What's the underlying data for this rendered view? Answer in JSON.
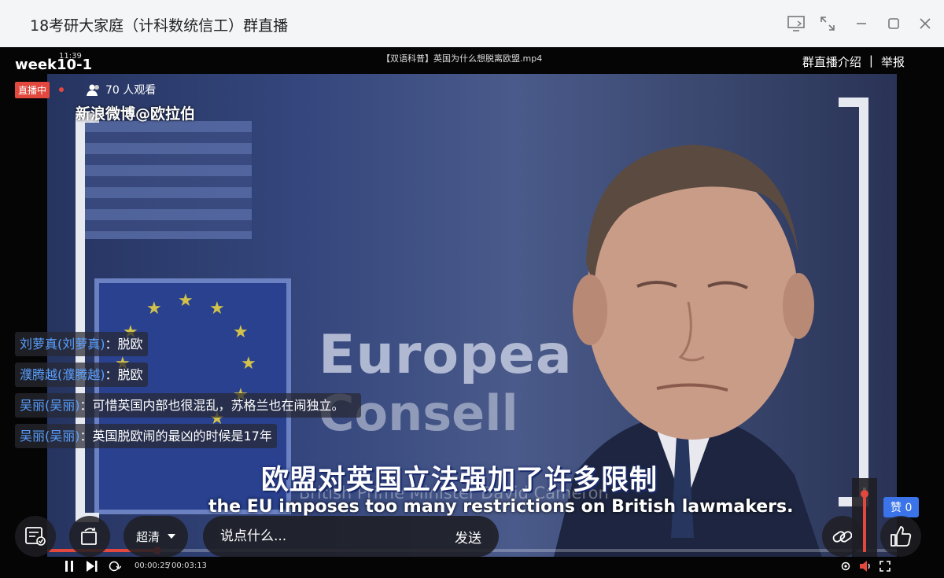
{
  "window": {
    "title": "18考研大家庭（计科数统信工）群直播"
  },
  "player": {
    "week_label": "week10-1",
    "clock": "11:39",
    "video_name": "【双语科普】英国为什么想脱离欧盟.mp4",
    "live_badge": "直播中",
    "viewers": "70 人观看",
    "watermark": "新浪微博@欧拉伯",
    "group_intro": "群直播介绍",
    "report": "举报",
    "separator": "|",
    "video_text_1": "Europea",
    "video_text_2": "Consell",
    "subtitle_cn": "欧盟对英国立法强加了许多限制",
    "subtitle_en": "the EU imposes too many restrictions on British lawmakers.",
    "subtitle_ghost": "British Prime Minister David Cameron",
    "progress_fraction": 0.13,
    "volume_fraction": 0.9
  },
  "chat": [
    {
      "user": "刘萝真(刘萝真)",
      "text": "：脱欧"
    },
    {
      "user": "濮腾越(濮腾越)",
      "text": "：脱欧"
    },
    {
      "user": "吴丽(吴丽)",
      "text": "：可惜英国内部也很混乱，苏格兰也在闹独立。"
    },
    {
      "user": "吴丽(吴丽)",
      "text": "：英国脱欧闹的最凶的时候是17年"
    }
  ],
  "controls": {
    "quality_label": "超清",
    "input_placeholder": "说点什么...",
    "send_label": "发送",
    "time_current": "00:00:25",
    "time_sep": "/",
    "time_total": "00:03:13",
    "like_label": "赞 0"
  },
  "colors": {
    "accent": "#e2483d",
    "chat_user": "#5aa0ff",
    "like_blue": "#3a74e8"
  }
}
